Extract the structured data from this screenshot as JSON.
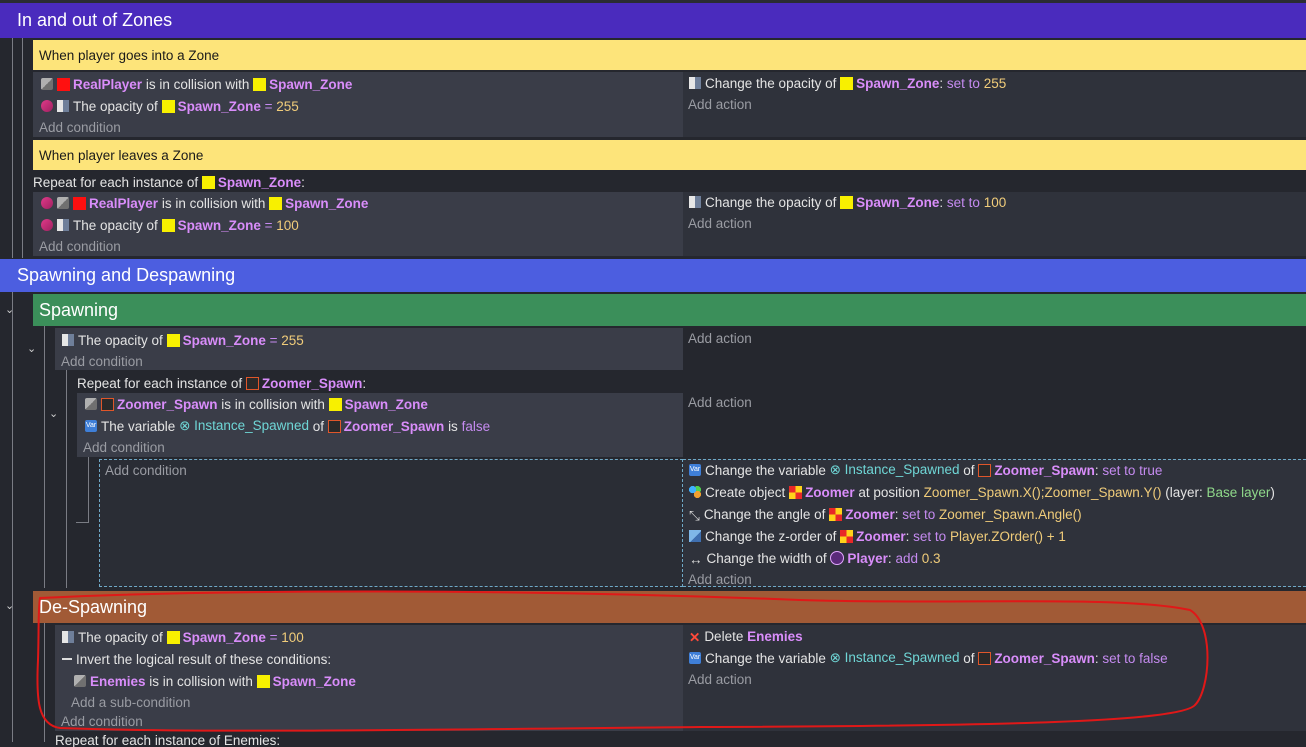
{
  "groups": {
    "zones_title": "In and out of Zones",
    "spawning_despawning_title": "Spawning and Despawning",
    "spawning_title": "Spawning",
    "despawning_title": "De-Spawning"
  },
  "comments": {
    "enter_zone": "When player goes into a Zone",
    "leave_zone": "When player leaves a Zone"
  },
  "labels": {
    "add_condition": "Add condition",
    "add_action": "Add action",
    "add_subcondition": "Add a sub-condition",
    "repeat_prefix": "Repeat for each instance of",
    "colon": ":",
    "is_in_collision_with": "is in collision with",
    "the_opacity_of": "The opacity of",
    "eq": "=",
    "change_opacity_of": "Change the opacity of",
    "set_to": "set to",
    "the_variable": "The variable",
    "of": "of",
    "is": "is",
    "change_the_variable": "Change the variable",
    "create_object": "Create object",
    "at_position": "at position",
    "layer_prefix": "(layer:",
    "layer_suffix": ")",
    "change_angle_of": "Change the angle of",
    "change_zorder_of": "Change the z-order of",
    "change_width_of": "Change the width of",
    "add": "add",
    "delete": "Delete",
    "invert": "Invert the logical result of these conditions:",
    "partial_bottom": "Repeat for each instance of Enemies:"
  },
  "objects": {
    "real_player": "RealPlayer",
    "spawn_zone": "Spawn_Zone",
    "zoomer_spawn": "Zoomer_Spawn",
    "zoomer": "Zoomer",
    "player": "Player",
    "enemies": "Enemies"
  },
  "values": {
    "v255": "255",
    "v100": "100",
    "false": "false",
    "true": "true",
    "instance_spawned": "Instance_Spawned",
    "position_expr": "Zoomer_Spawn.X();Zoomer_Spawn.Y()",
    "layer_name": "Base layer",
    "angle_expr": "Zoomer_Spawn.Angle()",
    "zorder_expr": "Player.ZOrder() + 1",
    "width_add": "0.3",
    "var_badge": "Var"
  },
  "colors": {
    "zones_band": "#4a2bbd",
    "spawn_band": "#4c5ee0",
    "spawning_band": "#3b8f5a",
    "despawning_band": "#a15a36",
    "comment": "#fde47a",
    "annotation": "#e01818"
  },
  "icons": {
    "collision": "collision-icon",
    "opacity": "opacity-icon",
    "invert": "invert-icon",
    "variable": "variable-icon",
    "delete": "delete-icon",
    "create": "create-object-icon",
    "angle": "angle-icon",
    "zorder": "zorder-icon",
    "width": "width-icon",
    "chevron": "chevron-down-icon"
  }
}
